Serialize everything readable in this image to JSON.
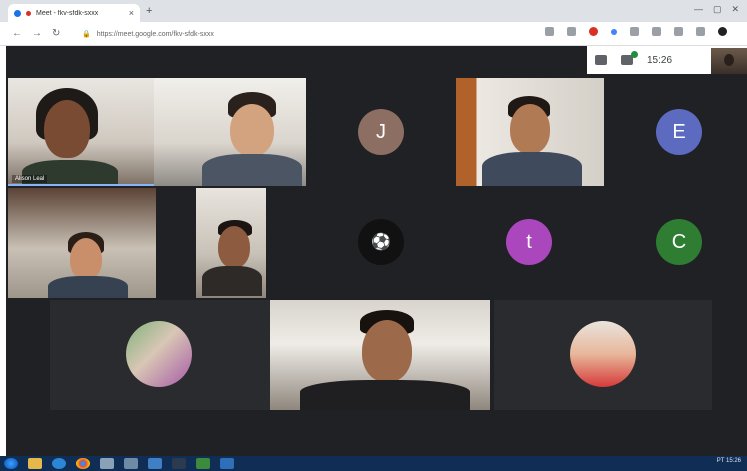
{
  "browser": {
    "tab_title": "Meet - fkv-sfdk-sxxx",
    "tab_close": "×",
    "new_tab": "+",
    "window_controls": [
      "—",
      "▢",
      "✕"
    ],
    "nav": [
      "←",
      "→",
      "↻"
    ],
    "url": "https://meet.google.com/fkv-sfdk-sxxx"
  },
  "meet": {
    "time": "15:26",
    "speaker_name": "Alison Leal",
    "avatars": [
      {
        "letter": "J",
        "color": "#8d6e63"
      },
      {
        "letter": "E",
        "color": "#5c6bc0"
      },
      {
        "letter": "t",
        "color": "#ab47bc"
      },
      {
        "letter": "C",
        "color": "#2e7d32"
      }
    ]
  },
  "colors": {
    "meet_bg": "#202124",
    "taskbar": "#0f2d55",
    "speaking_border": "#8ab4f8"
  },
  "taskbar": {
    "tray_text": "PT 15:26"
  }
}
